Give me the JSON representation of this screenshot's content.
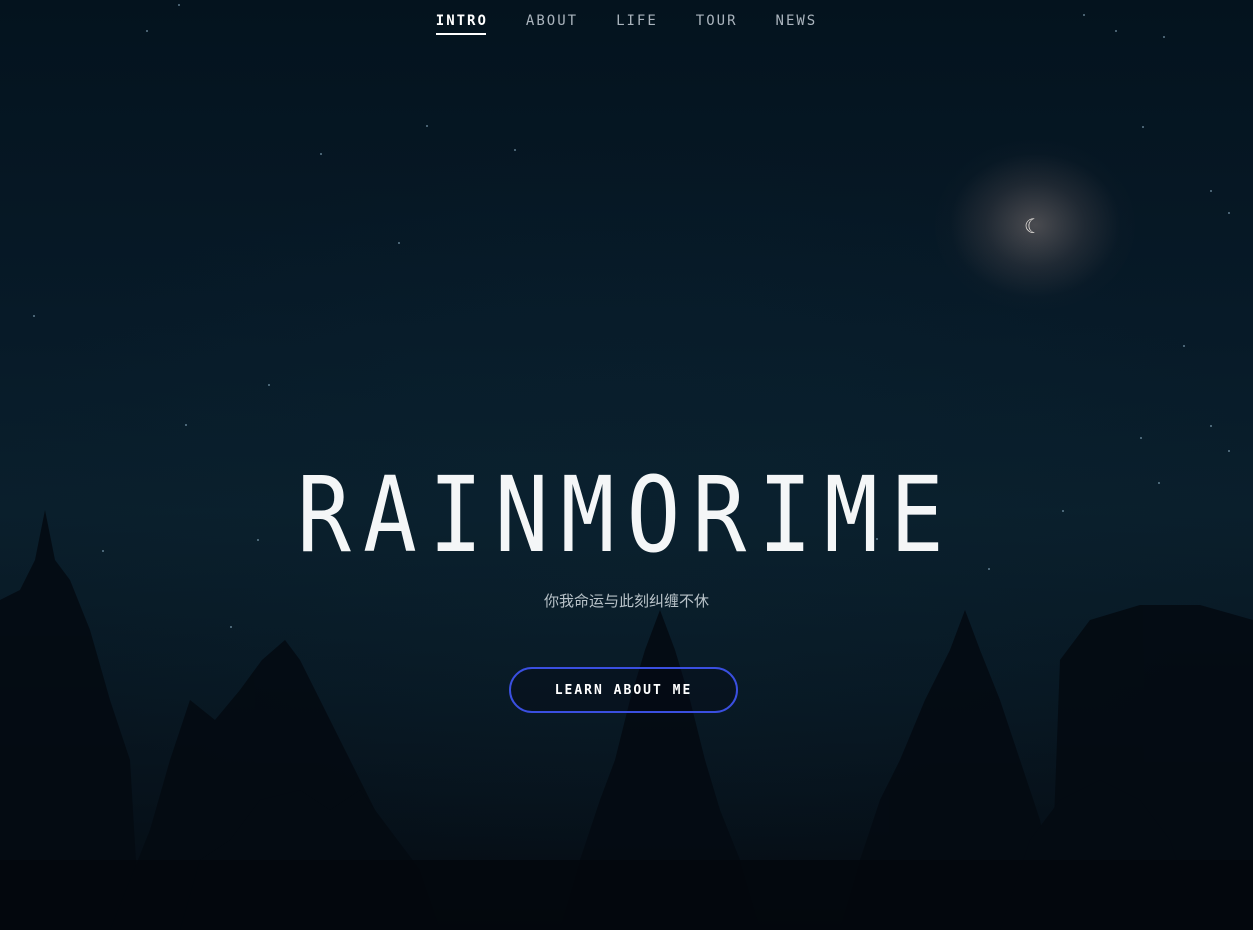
{
  "nav": {
    "items": [
      {
        "label": "INTRO",
        "active": true
      },
      {
        "label": "ABOUT",
        "active": false
      },
      {
        "label": "LIFE",
        "active": false
      },
      {
        "label": "TOUR",
        "active": false
      },
      {
        "label": "NEWS",
        "active": false
      }
    ]
  },
  "hero": {
    "title": "RAINMORIME",
    "subtitle": "你我命运与此刻纠缠不休",
    "cta_label": "LEARN ABOUT ME",
    "moon_glyph": "☾"
  },
  "colors": {
    "background": "#061521",
    "accent": "#3a4fe0",
    "nav_active": "#ffffff",
    "nav_inactive": "#aab4bd"
  }
}
